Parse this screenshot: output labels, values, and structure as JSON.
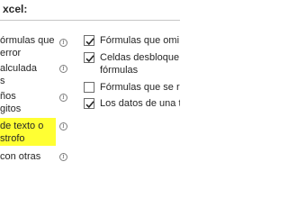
{
  "section": {
    "title": "xcel:"
  },
  "left": {
    "items": [
      {
        "lines": [
          "órmulas que",
          " error"
        ]
      },
      {
        "lines": [
          "alculada",
          "s"
        ]
      },
      {
        "lines": [
          "ños",
          "gitos"
        ]
      },
      {
        "lines": [
          "de texto o",
          "strofo"
        ],
        "highlighted": true
      },
      {
        "lines": [
          "con otras"
        ]
      }
    ]
  },
  "right": {
    "items": [
      {
        "lines": [
          "Fórmulas que omi"
        ],
        "checked": true
      },
      {
        "lines": [
          "Celdas desbloque",
          "fórmulas"
        ],
        "checked": true
      },
      {
        "lines": [
          "Fórmulas que se re"
        ],
        "checked": false
      },
      {
        "lines": [
          "Los datos de una t"
        ],
        "checked": true
      }
    ]
  },
  "icons": {
    "info": "info-icon",
    "check": "checkmark-icon"
  },
  "colors": {
    "highlight": "#ffff33",
    "text": "#262626",
    "rule": "#c6c6c6"
  }
}
